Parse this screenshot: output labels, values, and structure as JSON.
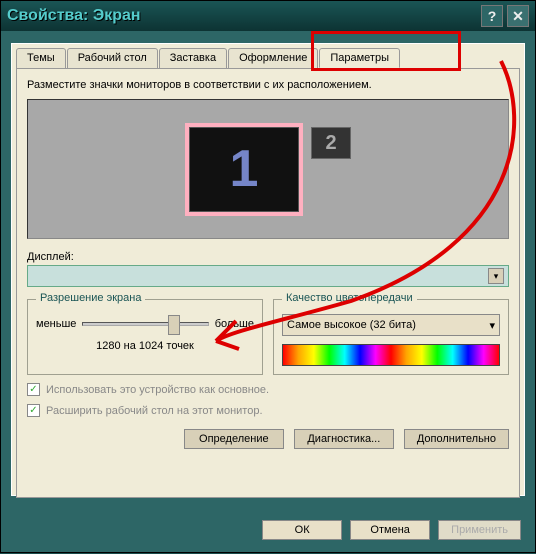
{
  "window": {
    "title": "Свойства: Экран"
  },
  "tabs": {
    "items": [
      "Темы",
      "Рабочий стол",
      "Заставка",
      "Оформление",
      "Параметры"
    ],
    "active": 4
  },
  "instruction": "Разместите значки мониторов в соответствии с их расположением.",
  "monitors": {
    "m1": "1",
    "m2": "2"
  },
  "display": {
    "label": "Дисплей:",
    "value": ""
  },
  "resolution": {
    "title": "Разрешение экрана",
    "less": "меньше",
    "more": "больше",
    "value": "1280 на 1024 точек"
  },
  "quality": {
    "title": "Качество цветопередачи",
    "value": "Самое высокое (32 бита)"
  },
  "checkboxes": {
    "primary": "Использовать это устройство как основное.",
    "extend": "Расширить рабочий стол на этот монитор."
  },
  "buttons": {
    "identify": "Определение",
    "troubleshoot": "Диагностика...",
    "advanced": "Дополнительно",
    "ok": "ОК",
    "cancel": "Отмена",
    "apply": "Применить"
  }
}
